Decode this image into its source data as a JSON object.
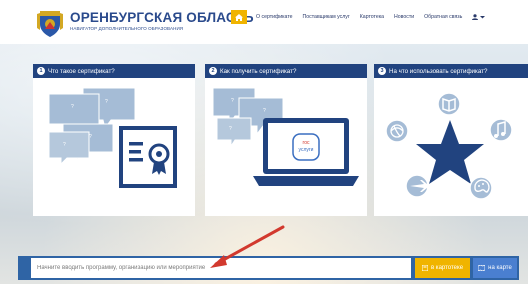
{
  "header": {
    "title": "ОРЕНБУРГСКАЯ ОБЛАСТЬ",
    "subtitle": "НАВИГАТОР ДОПОЛНИТЕЛЬНОГО ОБРАЗОВАНИЯ",
    "nav": [
      "О сертификате",
      "Поставщикам услуг",
      "Картотека",
      "Новости",
      "Обратная связь"
    ]
  },
  "cards": [
    {
      "number": "1",
      "title": "Что такое сертификат?"
    },
    {
      "number": "2",
      "title": "Как получить сертификат?",
      "screen_text_1": "гос",
      "screen_text_2": "услуги"
    },
    {
      "number": "3",
      "title": "На что использовать сертификат?"
    }
  ],
  "search": {
    "placeholder": "Начните вводить программу, организацию или мероприятие",
    "catalog_button": "в картотеке",
    "map_button": "на карте"
  },
  "colors": {
    "accent": "#f0b400",
    "brand_blue": "#21437f",
    "search_bar": "#2f64a5",
    "arrow": "#d2392e"
  }
}
